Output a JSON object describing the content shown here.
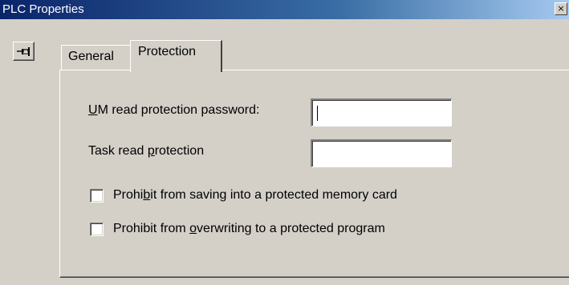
{
  "window": {
    "title": "PLC Properties",
    "close_glyph": "×"
  },
  "toolbar": {
    "pin_icon": "pushpin-icon"
  },
  "tabs": [
    {
      "label": "General",
      "selected": false
    },
    {
      "label": "Protection",
      "selected": true
    }
  ],
  "protection": {
    "um_password": {
      "label_pre": "",
      "label_mnemonic": "U",
      "label_post": "M read protection password:",
      "value": ""
    },
    "task_protection": {
      "label_pre": "Task read ",
      "label_mnemonic": "p",
      "label_post": "rotection",
      "value": ""
    },
    "checkboxes": [
      {
        "label_pre": "Prohi",
        "label_mnemonic": "b",
        "label_post": "it from saving into a protected memory card",
        "checked": false
      },
      {
        "label_pre": "Prohibit from ",
        "label_mnemonic": "o",
        "label_post": "verwriting to a protected program",
        "checked": false
      }
    ]
  }
}
